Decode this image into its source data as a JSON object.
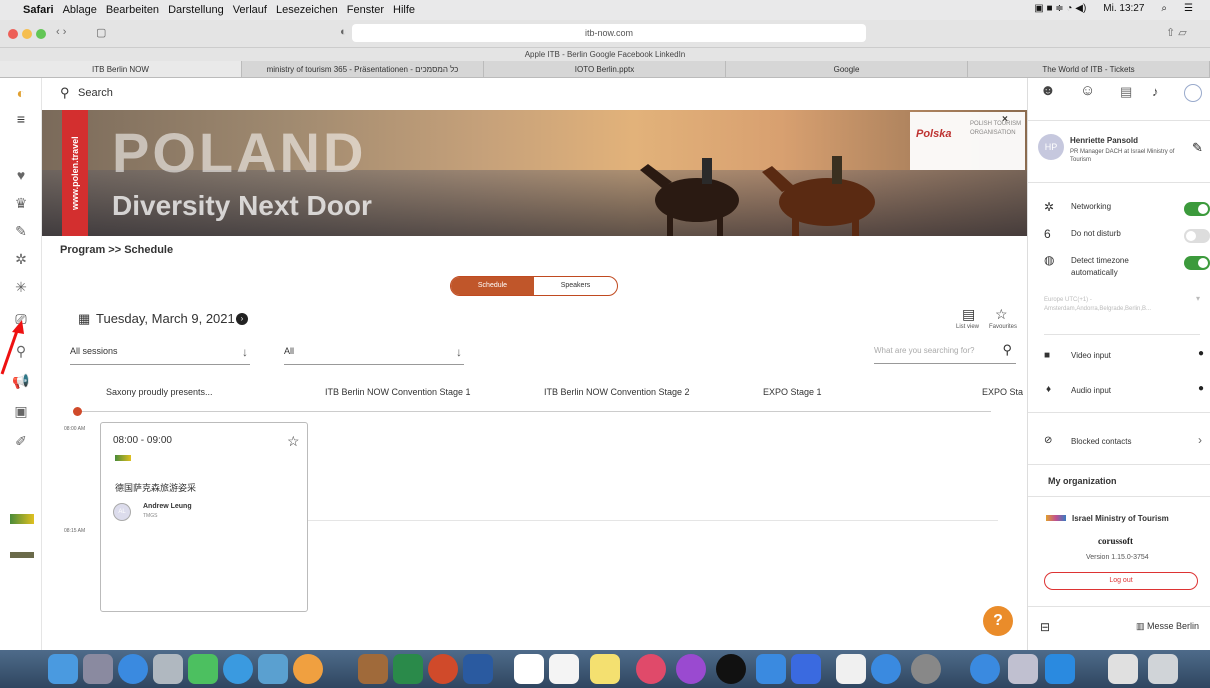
{
  "menubar": {
    "apple": "",
    "items": [
      "Safari",
      "Ablage",
      "Bearbeiten",
      "Darstellung",
      "Verlauf",
      "Lesezeichen",
      "Fenster",
      "Hilfe"
    ],
    "clock": "Mi. 13:27"
  },
  "browser": {
    "url": "itb-now.com",
    "favorites": "Apple  ITB - Berlin  Google  Facebook  LinkedIn",
    "tabs": [
      "ITB Berlin NOW",
      "ministry of tourism 365 - Präsentationen - כל המסמכים",
      "IOTO Berlin.pptx",
      "Google",
      "The World of ITB - Tickets"
    ]
  },
  "search": {
    "label": "Search"
  },
  "banner": {
    "site": "www.polen.travel",
    "title": "POLAND",
    "subtitle": "Diversity Next Door",
    "logo": "Polska",
    "org": "POLISH TOURISM ORGANISATION"
  },
  "breadcrumb": "Program >> Schedule",
  "view_toggle": {
    "schedule": "Schedule",
    "speakers": "Speakers"
  },
  "date": "Tuesday, March 9, 2021",
  "list_view": "List view",
  "favourites": "Favourites",
  "filters": {
    "sessions": "All sessions",
    "all": "All",
    "search_placeholder": "What are you searching for?"
  },
  "stages": [
    "Saxony proudly presents...",
    "ITB Berlin NOW Convention Stage 1",
    "ITB Berlin NOW Convention Stage 2",
    "EXPO Stage 1",
    "EXPO Sta"
  ],
  "times": {
    "t1": "08:00 AM",
    "t2": "08:15 AM"
  },
  "session": {
    "time": "08:00 - 09:00",
    "title": "德国萨克森旅游姿采",
    "speaker": "Andrew Leung",
    "speaker_org": "TMGS",
    "avatar": "AL"
  },
  "profile": {
    "initials": "HP",
    "name": "Henriette Pansold",
    "role": "PR Manager DACH at Israel Ministry of Tourism"
  },
  "settings": {
    "networking": "Networking",
    "dnd": "Do not disturb",
    "timezone": "Detect timezone automatically",
    "tz_value": "Europe UTC(+1) - Amsterdam,Andorra,Belgrade,Berlin,B...",
    "video": "Video input",
    "audio": "Audio input",
    "blocked": "Blocked contacts"
  },
  "organization": {
    "heading": "My organization",
    "name": "Israel Ministry of Tourism",
    "brand": "corussoft",
    "version": "Version 1.15.0-3754",
    "logout": "Log out"
  },
  "footer": {
    "messe": "Messe Berlin"
  },
  "help": "?"
}
